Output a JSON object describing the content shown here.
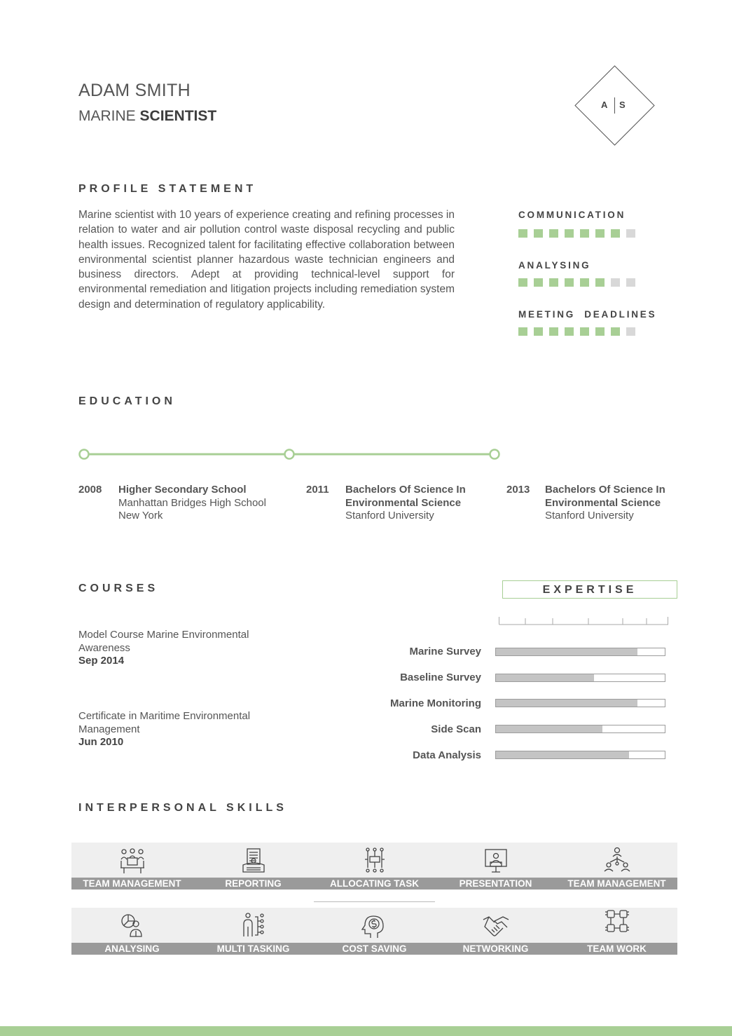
{
  "header": {
    "name": "ADAM SMITH",
    "role_light": "MARINE",
    "role_bold": "SCIENTIST",
    "monogram_left": "A",
    "monogram_right": "S"
  },
  "profile": {
    "title": "PROFILE STATEMENT",
    "text": "Marine scientist with 10 years of experience creating and refining processes in relation to water and air pollution control waste disposal recycling and public health issues. Recognized talent for facilitating effective collaboration between environmental scientist planner hazardous waste technician engineers and business directors. Adept at providing technical-level support for environmental remediation and litigation projects including remediation system design and determination of regulatory applicability."
  },
  "skills": [
    {
      "name": "COMMUNICATION",
      "level": 7,
      "max": 8
    },
    {
      "name": "ANALYSING",
      "level": 6,
      "max": 8
    },
    {
      "name": "MEETING  DEADLINES",
      "level": 7,
      "max": 8
    }
  ],
  "education": {
    "title": "EDUCATION",
    "entries": [
      {
        "year": "2008",
        "title": "Higher Secondary School",
        "line2": "Manhattan Bridges High School",
        "line3": "New York"
      },
      {
        "year": "2011",
        "title": "Bachelors Of Science In",
        "line2": "Environmental Science",
        "line3": "Stanford  University"
      },
      {
        "year": "2013",
        "title": "Bachelors Of Science In",
        "line2": "Environmental Science",
        "line3": "Stanford  University"
      }
    ]
  },
  "courses": {
    "title": "COURSES",
    "items": [
      {
        "name_line1": "Model Course Marine Environmental",
        "name_line2": "Awareness",
        "date": "Sep 2014"
      },
      {
        "name_line1": "Certificate in Maritime Environmental",
        "name_line2": "Management",
        "date": "Jun 2010"
      }
    ]
  },
  "expertise": {
    "title": "EXPERTISE",
    "items": [
      {
        "label": "Marine Survey",
        "value": 0.84
      },
      {
        "label": "Baseline Survey",
        "value": 0.58
      },
      {
        "label": "Marine Monitoring",
        "value": 0.84
      },
      {
        "label": "Side Scan",
        "value": 0.63
      },
      {
        "label": "Data Analysis",
        "value": 0.79
      }
    ]
  },
  "interpersonal": {
    "title": "INTERPERSONAL SKILLS",
    "row1": [
      {
        "label": "TEAM MANAGEMENT",
        "icon": "team-meeting-icon"
      },
      {
        "label": "REPORTING",
        "icon": "report-icon"
      },
      {
        "label": "ALLOCATING TASK",
        "icon": "task-network-icon"
      },
      {
        "label": "PRESENTATION",
        "icon": "presentation-icon"
      },
      {
        "label": "TEAM MANAGEMENT",
        "icon": "org-chart-icon"
      }
    ],
    "row2": [
      {
        "label": "ANALYSING",
        "icon": "analysis-person-icon"
      },
      {
        "label": "MULTI TASKING",
        "icon": "multitask-icon"
      },
      {
        "label": "COST SAVING",
        "icon": "dollar-head-icon"
      },
      {
        "label": "NETWORKING",
        "icon": "handshake-icon"
      },
      {
        "label": "TEAM WORK",
        "icon": "teamwork-hands-icon"
      }
    ]
  },
  "colors": {
    "accent": "#a8cf95",
    "band": "#9a9a9a",
    "bar_fill": "#c4c4c4"
  }
}
